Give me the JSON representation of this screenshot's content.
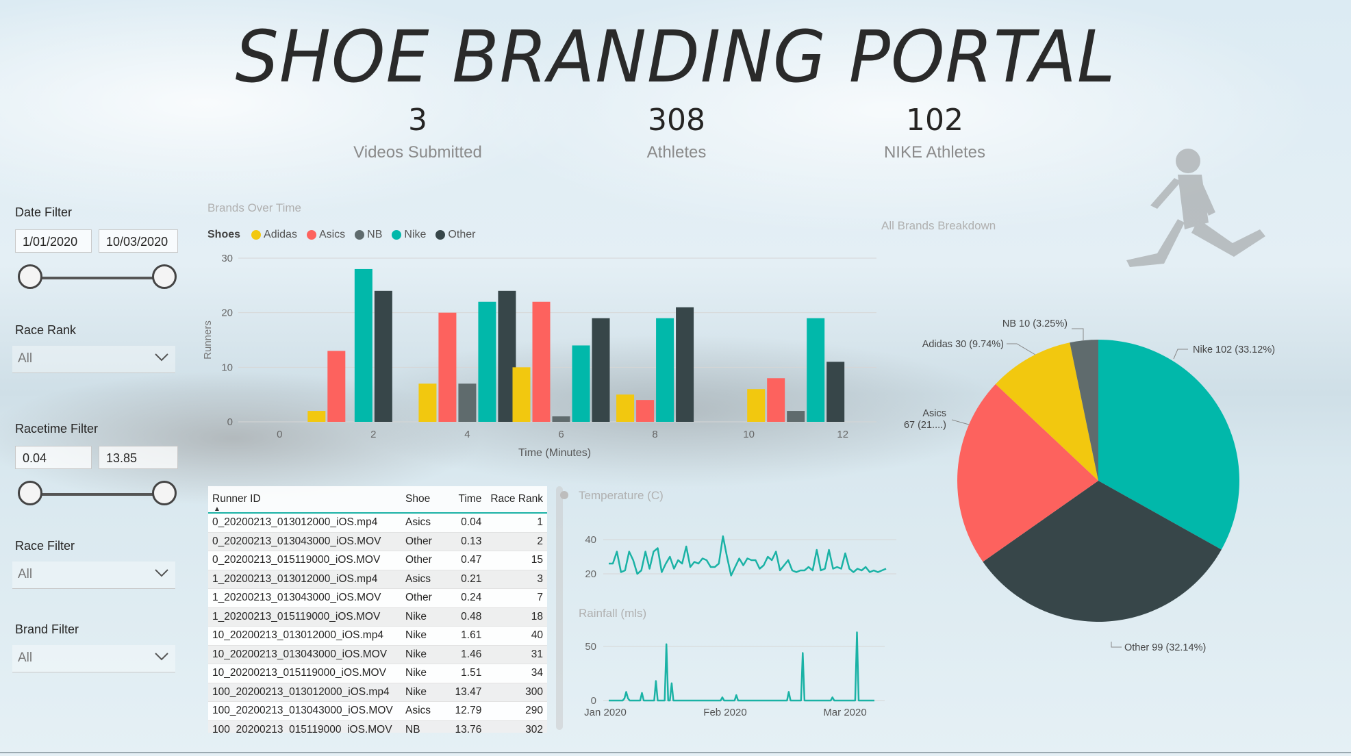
{
  "title": "SHOE BRANDING PORTAL",
  "kpis": [
    {
      "value": "3",
      "label": "Videos Submitted"
    },
    {
      "value": "308",
      "label": "Athletes"
    },
    {
      "value": "102",
      "label": "NIKE Athletes"
    }
  ],
  "filters": {
    "date": {
      "label": "Date Filter",
      "start": "1/01/2020",
      "end": "10/03/2020"
    },
    "race_rank": {
      "label": "Race Rank",
      "value": "All"
    },
    "racetime": {
      "label": "Racetime Filter",
      "min": "0.04",
      "max": "13.85"
    },
    "race": {
      "label": "Race Filter",
      "value": "All"
    },
    "brand": {
      "label": "Brand Filter",
      "value": "All"
    }
  },
  "colors": {
    "Adidas": "#F2C80F",
    "Asics": "#FD625E",
    "NB": "#5F6B6D",
    "Nike": "#01B8AA",
    "Other": "#374649",
    "line": "#1ab2a5"
  },
  "icons": [
    "chevron-down-icon",
    "sort-ascending-icon",
    "runner-silhouette-icon"
  ],
  "chart_data": [
    {
      "type": "bar",
      "title": "Brands Over Time",
      "legend_title": "Shoes",
      "legend_position": "top-left",
      "xlabel": "Time (Minutes)",
      "ylabel": "Runners",
      "xticks": [
        0,
        2,
        4,
        6,
        8,
        10,
        12
      ],
      "ylim": [
        0,
        30
      ],
      "yticks": [
        0,
        10,
        20,
        30
      ],
      "grid": true,
      "categories": [
        0,
        1,
        2,
        3,
        4,
        5,
        6,
        7,
        8,
        9,
        10,
        11,
        12
      ],
      "series": [
        {
          "name": "Adidas",
          "values": [
            null,
            2,
            null,
            null,
            7,
            null,
            10,
            null,
            5,
            null,
            null,
            6,
            null
          ]
        },
        {
          "name": "Asics",
          "values": [
            null,
            13,
            null,
            null,
            20,
            null,
            22,
            null,
            4,
            null,
            null,
            8,
            null
          ]
        },
        {
          "name": "NB",
          "values": [
            null,
            null,
            null,
            null,
            7,
            null,
            1,
            null,
            null,
            null,
            null,
            2,
            null
          ]
        },
        {
          "name": "Nike",
          "values": [
            null,
            null,
            28,
            null,
            22,
            null,
            14,
            null,
            19,
            null,
            null,
            19,
            null
          ]
        },
        {
          "name": "Other",
          "values": [
            null,
            null,
            24,
            null,
            24,
            null,
            19,
            null,
            21,
            null,
            null,
            11,
            null
          ]
        }
      ]
    },
    {
      "type": "line",
      "title": "Temperature (C)",
      "yticks": [
        20,
        40
      ],
      "ylim": [
        12,
        48
      ],
      "xlim": [
        "2020-01-01",
        "2020-03-10"
      ],
      "series": [
        {
          "values": [
            26,
            26,
            33,
            21,
            22,
            33,
            28,
            20,
            22,
            33,
            23,
            33,
            35,
            21,
            26,
            30,
            23,
            28,
            26,
            36,
            24,
            27,
            26,
            29,
            28,
            24,
            24,
            26,
            42,
            30,
            19,
            24,
            29,
            25,
            29,
            28,
            28,
            23,
            25,
            30,
            28,
            33,
            22,
            25,
            28,
            22,
            21,
            22,
            22,
            24,
            22,
            34,
            22,
            23,
            34,
            23,
            24,
            23,
            32,
            23,
            21,
            23,
            22,
            24,
            21,
            22,
            21,
            22,
            23
          ]
        }
      ]
    },
    {
      "type": "line",
      "title": "Rainfall (mls)",
      "yticks": [
        0,
        50
      ],
      "xticks": [
        "Jan 2020",
        "Feb 2020",
        "Mar 2020"
      ],
      "ylim": [
        0,
        62
      ],
      "xlim": [
        "2020-01-01",
        "2020-03-10"
      ],
      "series": [
        {
          "values": [
            0,
            0,
            0,
            0,
            0,
            0,
            0,
            0,
            0,
            2,
            8,
            2,
            0,
            0,
            0,
            0,
            0,
            0,
            0,
            7,
            0,
            0,
            0,
            0,
            0,
            0,
            0,
            18,
            0,
            0,
            0,
            0,
            0,
            52,
            0,
            0,
            16,
            0,
            0,
            0,
            0,
            0,
            0,
            0,
            0,
            0,
            0,
            0,
            0,
            0,
            0,
            0,
            0,
            0,
            0,
            0,
            0,
            0,
            0,
            0,
            0,
            0,
            0,
            0,
            0,
            3,
            0,
            0,
            0,
            0,
            0,
            0,
            0,
            5,
            0,
            0,
            0,
            0,
            0,
            0,
            0,
            0,
            0,
            0,
            0,
            0,
            0,
            0,
            0,
            0,
            0,
            0,
            0,
            0,
            0,
            0,
            0,
            0,
            0,
            0,
            0,
            0,
            0,
            8,
            0,
            0,
            0,
            0,
            0,
            0,
            0,
            44,
            0,
            0,
            0,
            0,
            0,
            0,
            0,
            0,
            0,
            0,
            0,
            0,
            0,
            0,
            0,
            0,
            3,
            0,
            0,
            0,
            0,
            0,
            0,
            0,
            0,
            0,
            0,
            0,
            0,
            0,
            63,
            0,
            0,
            0,
            0,
            0,
            0,
            0,
            0,
            0,
            0
          ]
        }
      ]
    },
    {
      "type": "pie",
      "title": "All Brands Breakdown",
      "slices": [
        {
          "name": "Nike",
          "value": 102,
          "label": "Nike 102 (33.12%)"
        },
        {
          "name": "Other",
          "value": 99,
          "label": "Other 99 (32.14%)"
        },
        {
          "name": "Asics",
          "value": 67,
          "label_line1": "Asics",
          "label_line2": "67 (21....)"
        },
        {
          "name": "Adidas",
          "value": 30,
          "label": "Adidas 30 (9.74%)"
        },
        {
          "name": "NB",
          "value": 10,
          "label": "NB 10 (3.25%)"
        }
      ]
    }
  ],
  "table": {
    "columns": [
      "Runner ID",
      "Shoe",
      "Time",
      "Race Rank"
    ],
    "rows": [
      [
        "0_20200213_013012000_iOS.mp4",
        "Asics",
        "0.04",
        "1"
      ],
      [
        "0_20200213_013043000_iOS.MOV",
        "Other",
        "0.13",
        "2"
      ],
      [
        "0_20200213_015119000_iOS.MOV",
        "Other",
        "0.47",
        "15"
      ],
      [
        "1_20200213_013012000_iOS.mp4",
        "Asics",
        "0.21",
        "3"
      ],
      [
        "1_20200213_013043000_iOS.MOV",
        "Other",
        "0.24",
        "7"
      ],
      [
        "1_20200213_015119000_iOS.MOV",
        "Nike",
        "0.48",
        "18"
      ],
      [
        "10_20200213_013012000_iOS.mp4",
        "Nike",
        "1.61",
        "40"
      ],
      [
        "10_20200213_013043000_iOS.MOV",
        "Nike",
        "1.46",
        "31"
      ],
      [
        "10_20200213_015119000_iOS.MOV",
        "Nike",
        "1.51",
        "34"
      ],
      [
        "100_20200213_013012000_iOS.mp4",
        "Nike",
        "13.47",
        "300"
      ],
      [
        "100_20200213_013043000_iOS.MOV",
        "Asics",
        "12.79",
        "290"
      ],
      [
        "100_20200213_015119000_iOS.MOV",
        "NB",
        "13.76",
        "302"
      ]
    ]
  }
}
